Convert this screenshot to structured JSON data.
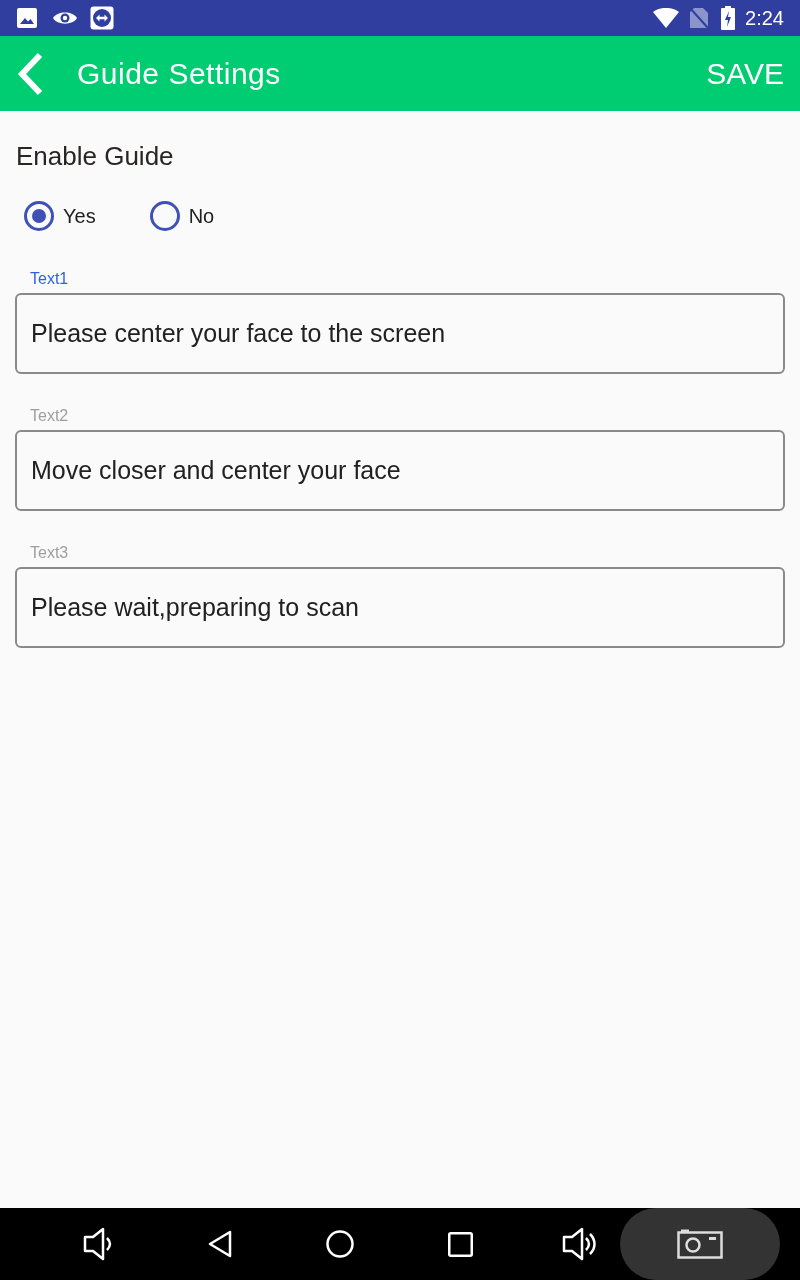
{
  "status_bar": {
    "time": "2:24"
  },
  "app_bar": {
    "title": "Guide Settings",
    "action": "SAVE"
  },
  "enable_guide": {
    "label": "Enable Guide",
    "options": [
      {
        "label": "Yes",
        "selected": true
      },
      {
        "label": "No",
        "selected": false
      }
    ]
  },
  "fields": [
    {
      "label": "Text1",
      "value": "Please center your face to the screen",
      "focused": true
    },
    {
      "label": "Text2",
      "value": "Move closer and center your face",
      "focused": false
    },
    {
      "label": "Text3",
      "value": "Please wait,preparing to scan",
      "focused": false
    }
  ]
}
